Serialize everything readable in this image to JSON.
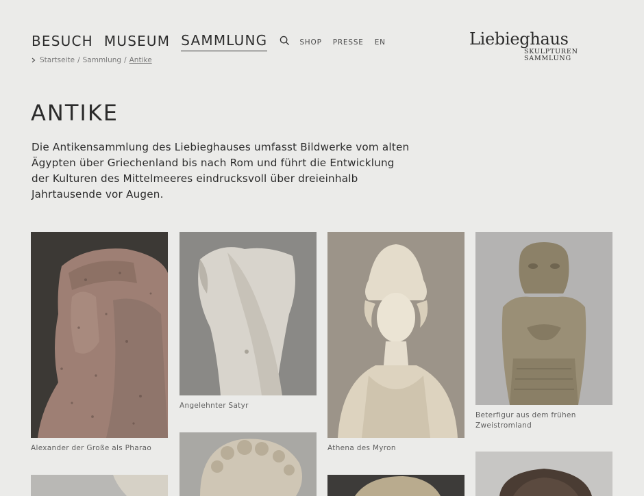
{
  "nav": {
    "main": [
      "BESUCH",
      "MUSEUM",
      "SAMMLUNG"
    ],
    "secondary": [
      "SHOP",
      "PRESSE",
      "EN"
    ]
  },
  "logo": {
    "name": "Liebieghaus",
    "line1": "SKULPTUREN",
    "line2": "SAMMLUNG"
  },
  "breadcrumb": {
    "items": [
      "Startseite",
      "Sammlung",
      "Antike"
    ],
    "separator": "/"
  },
  "page": {
    "title": "ANTIKE",
    "intro": "Die Antikensammlung des Liebieghauses umfasst Bildwerke vom alten Ägypten über Griechenland bis nach Rom und führt die Entwicklung der Kulturen des Mittelmeeres eindrucksvoll über dreieinhalb Jahrtausende vor Augen."
  },
  "gallery": [
    {
      "caption": "Alexander der Große als Pharao"
    },
    {
      "caption": "Angelehnter Satyr"
    },
    {
      "caption": "Athena des Myron"
    },
    {
      "caption": "Beterfigur aus dem frühen Zweistromland"
    },
    {
      "caption": ""
    },
    {
      "caption": ""
    },
    {
      "caption": ""
    },
    {
      "caption": ""
    }
  ],
  "colors": {
    "background": "#ebebe9",
    "text": "#2b2b2b",
    "muted": "#7a7a7a"
  }
}
